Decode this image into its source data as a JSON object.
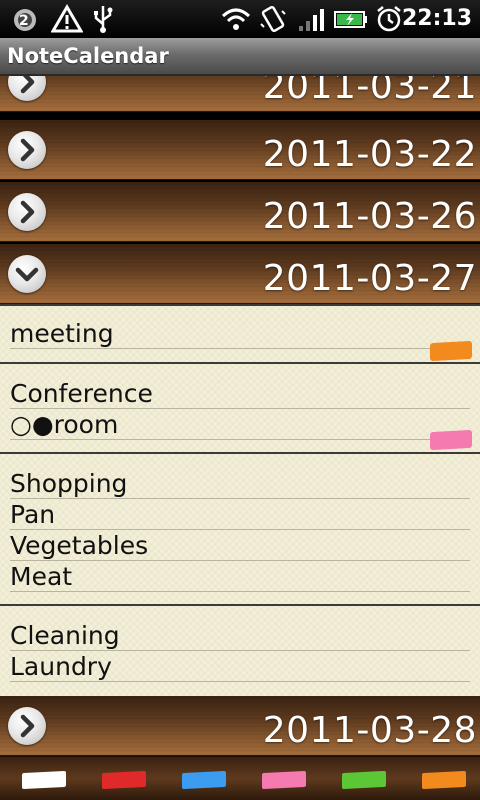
{
  "status_bar": {
    "time": "22:13",
    "icons": [
      "app-notification-icon",
      "warning-icon",
      "usb-icon",
      "wifi-icon",
      "vibrate-icon",
      "signal-icon",
      "battery-icon",
      "alarm-icon"
    ]
  },
  "app": {
    "title": "NoteCalendar"
  },
  "dates": [
    {
      "date": "2011-03-21",
      "expanded": false
    },
    {
      "date": "2011-03-22",
      "expanded": false
    },
    {
      "date": "2011-03-26",
      "expanded": false
    },
    {
      "date": "2011-03-27",
      "expanded": true
    },
    {
      "date": "2011-03-28",
      "expanded": false
    }
  ],
  "notes": [
    {
      "lines": [
        "meeting"
      ],
      "tag_color": "#f28a1e"
    },
    {
      "lines": [
        "Conference",
        "○●room"
      ],
      "tag_color": "#f47ab0"
    },
    {
      "lines": [
        "Shopping",
        "Pan",
        "Vegetables",
        "Meat"
      ],
      "tag_color": ""
    },
    {
      "lines": [
        "Cleaning",
        "Laundry"
      ],
      "tag_color": ""
    }
  ],
  "palette": {
    "colors": [
      "#ffffff",
      "#e02a2a",
      "#3b9cf0",
      "#f47ab0",
      "#5cc736",
      "#f28a1e"
    ]
  }
}
